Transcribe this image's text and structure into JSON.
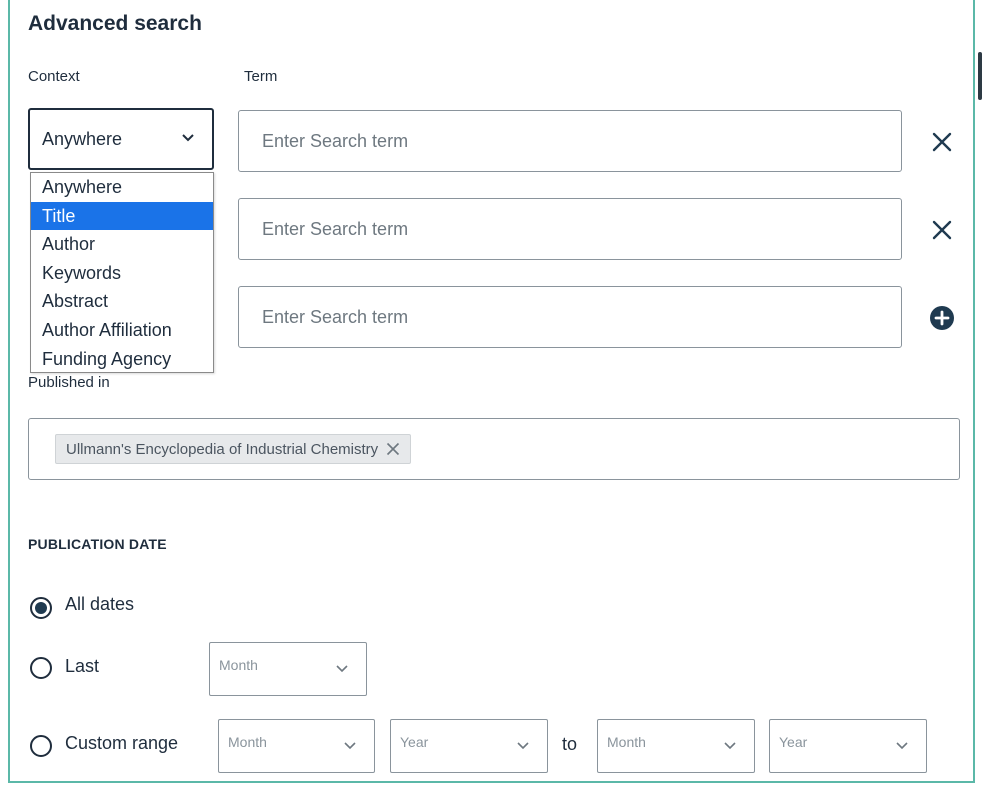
{
  "header": {
    "title": "Advanced search"
  },
  "columns": {
    "context": "Context",
    "term": "Term"
  },
  "context_select": {
    "value": "Anywhere",
    "options": [
      "Anywhere",
      "Title",
      "Author",
      "Keywords",
      "Abstract",
      "Author Affiliation",
      "Funding Agency"
    ],
    "highlighted": "Title"
  },
  "term_rows": [
    {
      "placeholder": "Enter Search term",
      "action": "remove"
    },
    {
      "placeholder": "Enter Search term",
      "action": "remove"
    },
    {
      "placeholder": "Enter Search term",
      "action": "add"
    }
  ],
  "published_in": {
    "label": "Published in",
    "chip": "Ullmann's Encyclopedia of Industrial Chemistry"
  },
  "publication_date": {
    "title": "PUBLICATION DATE",
    "options": {
      "all_dates": "All dates",
      "last": "Last",
      "custom_range": "Custom range"
    },
    "selected": "all_dates",
    "last_month": "Month",
    "range_from_month": "Month",
    "range_from_year": "Year",
    "to_label": "to",
    "range_to_month": "Month",
    "range_to_year": "Year"
  },
  "colors": {
    "accent_border": "#5bb8a8",
    "dark": "#1f2d3d",
    "highlight": "#1a73e8",
    "add_icon": "#1f3a50"
  }
}
